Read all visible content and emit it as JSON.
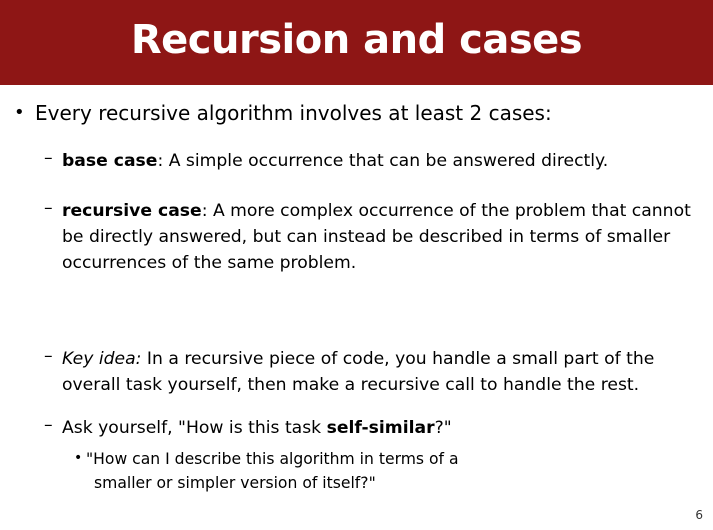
{
  "slide": {
    "title": "Recursion and cases",
    "page_number": "6"
  },
  "main_bullet": {
    "text": "Every recursive algorithm involves at least 2 cases:"
  },
  "base_case": {
    "term": "base case",
    "rest": ": A simple occurrence that can be answered directly."
  },
  "recursive_case": {
    "term": "recursive case",
    "line1_rest": ": A more complex occurrence of the problem that cannot",
    "line2": "be directly answered, but can instead be described in terms of smaller",
    "line3": "occurrences of the same problem."
  },
  "key_idea": {
    "term": "Key idea:",
    "line1_rest": " In a recursive piece of code, you handle a small part of the",
    "line2": "overall task yourself, then make a recursive call to handle the rest."
  },
  "ask_yourself": {
    "prefix": "Ask yourself, \"How is this task ",
    "term": "self-similar",
    "suffix": "?\""
  },
  "sub_question": {
    "line1": "\"How can I describe this algorithm in terms of a",
    "line2": "smaller or simpler version of itself?\""
  }
}
